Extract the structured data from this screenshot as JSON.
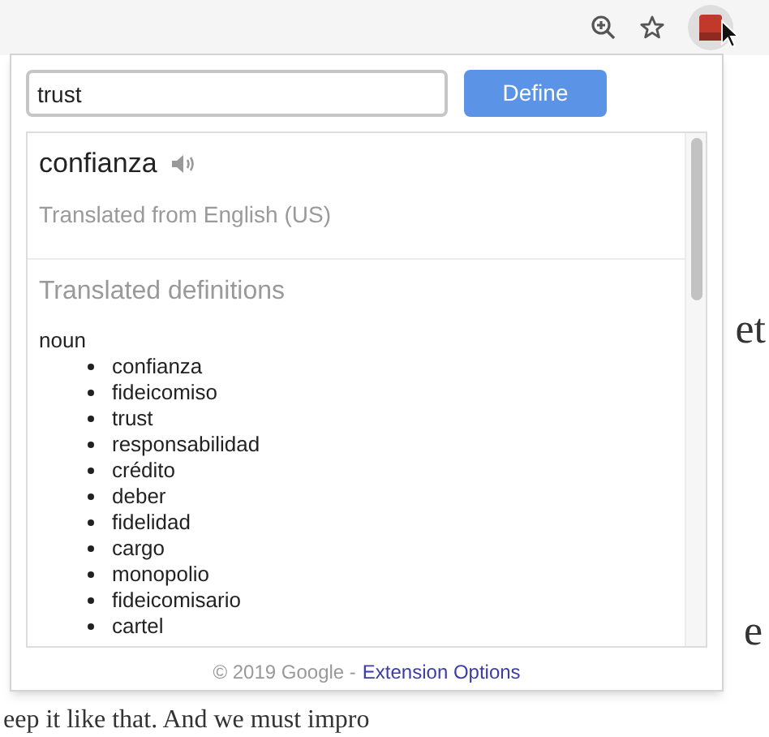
{
  "toolbar": {
    "extension_active": true
  },
  "background_text": [
    "et",
    "e",
    "eep it like that. And we must impro"
  ],
  "popup": {
    "search": {
      "value": "trust"
    },
    "define_button": "Define",
    "result": {
      "word": "confianza",
      "source": "Translated from English (US)"
    },
    "definitions": {
      "heading": "Translated definitions",
      "groups": [
        {
          "part_of_speech": "noun",
          "items": [
            "confianza",
            "fideicomiso",
            "trust",
            "responsabilidad",
            "crédito",
            "deber",
            "fidelidad",
            "cargo",
            "monopolio",
            "fideicomisario",
            "cartel"
          ]
        }
      ]
    },
    "footer": {
      "text": "© 2019 Google -",
      "link": "Extension Options"
    }
  }
}
